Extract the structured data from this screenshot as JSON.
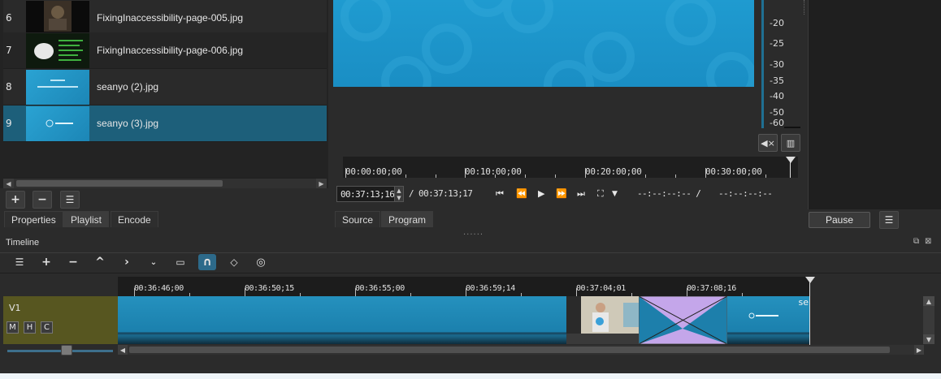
{
  "playlist": {
    "rows": [
      {
        "num": "6",
        "filename": "FixingInaccessibility-page-005.jpg"
      },
      {
        "num": "7",
        "filename": "FixingInaccessibility-page-006.jpg"
      },
      {
        "num": "8",
        "filename": "seanyo (2).jpg"
      },
      {
        "num": "9",
        "filename": "seanyo (3).jpg"
      }
    ],
    "selected_row": "9"
  },
  "left_tabs": [
    "Properties",
    "Playlist",
    "Encode"
  ],
  "viewer_tabs": [
    "Source",
    "Program"
  ],
  "viewer": {
    "ruler_labels": [
      "00:00:00;00",
      "00:10:00;00",
      "00:20:00;00",
      "00:30:00;00"
    ],
    "current_timecode": "00:37:13;16",
    "duration": "/ 00:37:13;17",
    "in_point": "--:--:--:-- /",
    "out_point": "--:--:--:--"
  },
  "meter": {
    "scale": [
      "-20",
      "-25",
      "-30",
      "-35",
      "-40",
      "-50",
      "-60"
    ]
  },
  "pause_label": "Pause",
  "timeline": {
    "title": "Timeline",
    "ruler_labels": [
      "00:36:46;00",
      "00:36:50;15",
      "00:36:55;00",
      "00:36:59;14",
      "00:37:04;01",
      "00:37:08;16"
    ],
    "track": {
      "name": "V1",
      "buttons": [
        "M",
        "H",
        "C"
      ]
    },
    "clip_label": "se"
  },
  "colors": {
    "accent": "#1d5f7a",
    "clip_blue": "#2591be",
    "track_header": "#575620",
    "transition": "#c4a6ea"
  }
}
